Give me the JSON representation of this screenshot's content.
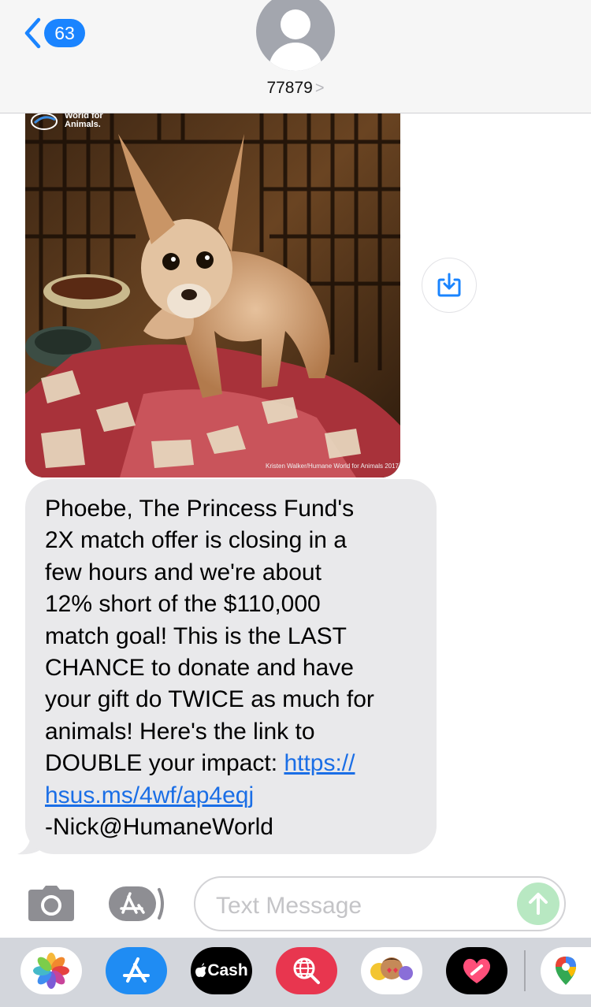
{
  "header": {
    "back_count": "63",
    "contact_name": "77879",
    "contact_chevron": ">"
  },
  "attachment": {
    "watermark_line1": "World for",
    "watermark_line2": "Animals.",
    "photo_credit": "Kristen Walker/Humane World for Animals 2017",
    "subject": "dog"
  },
  "message": {
    "text": "Phoebe, The Princess Fund's\n2X match offer is closing in a\nfew hours and we're about\n12% short of the $110,000\nmatch goal! This is the LAST\nCHANCE to donate and have\nyour gift do TWICE as much for\nanimals! Here's the link to\nDOUBLE your impact: ",
    "link_line1": "https://",
    "link_line2": "hsus.ms/4wf/ap4eqj",
    "signature": "-Nick@HumaneWorld"
  },
  "composer": {
    "placeholder": "Text Message"
  },
  "app_drawer": {
    "cash_label": "Cash",
    "items": [
      "photos-app",
      "app-store-app",
      "apple-cash-app",
      "web-search-app",
      "memoji-app",
      "digital-touch-app",
      "maps-app"
    ]
  },
  "colors": {
    "accent": "#1a84ff",
    "link": "#1a6ee6",
    "bubble": "#e9e9eb",
    "send_disabled": "#b8e8c2"
  }
}
